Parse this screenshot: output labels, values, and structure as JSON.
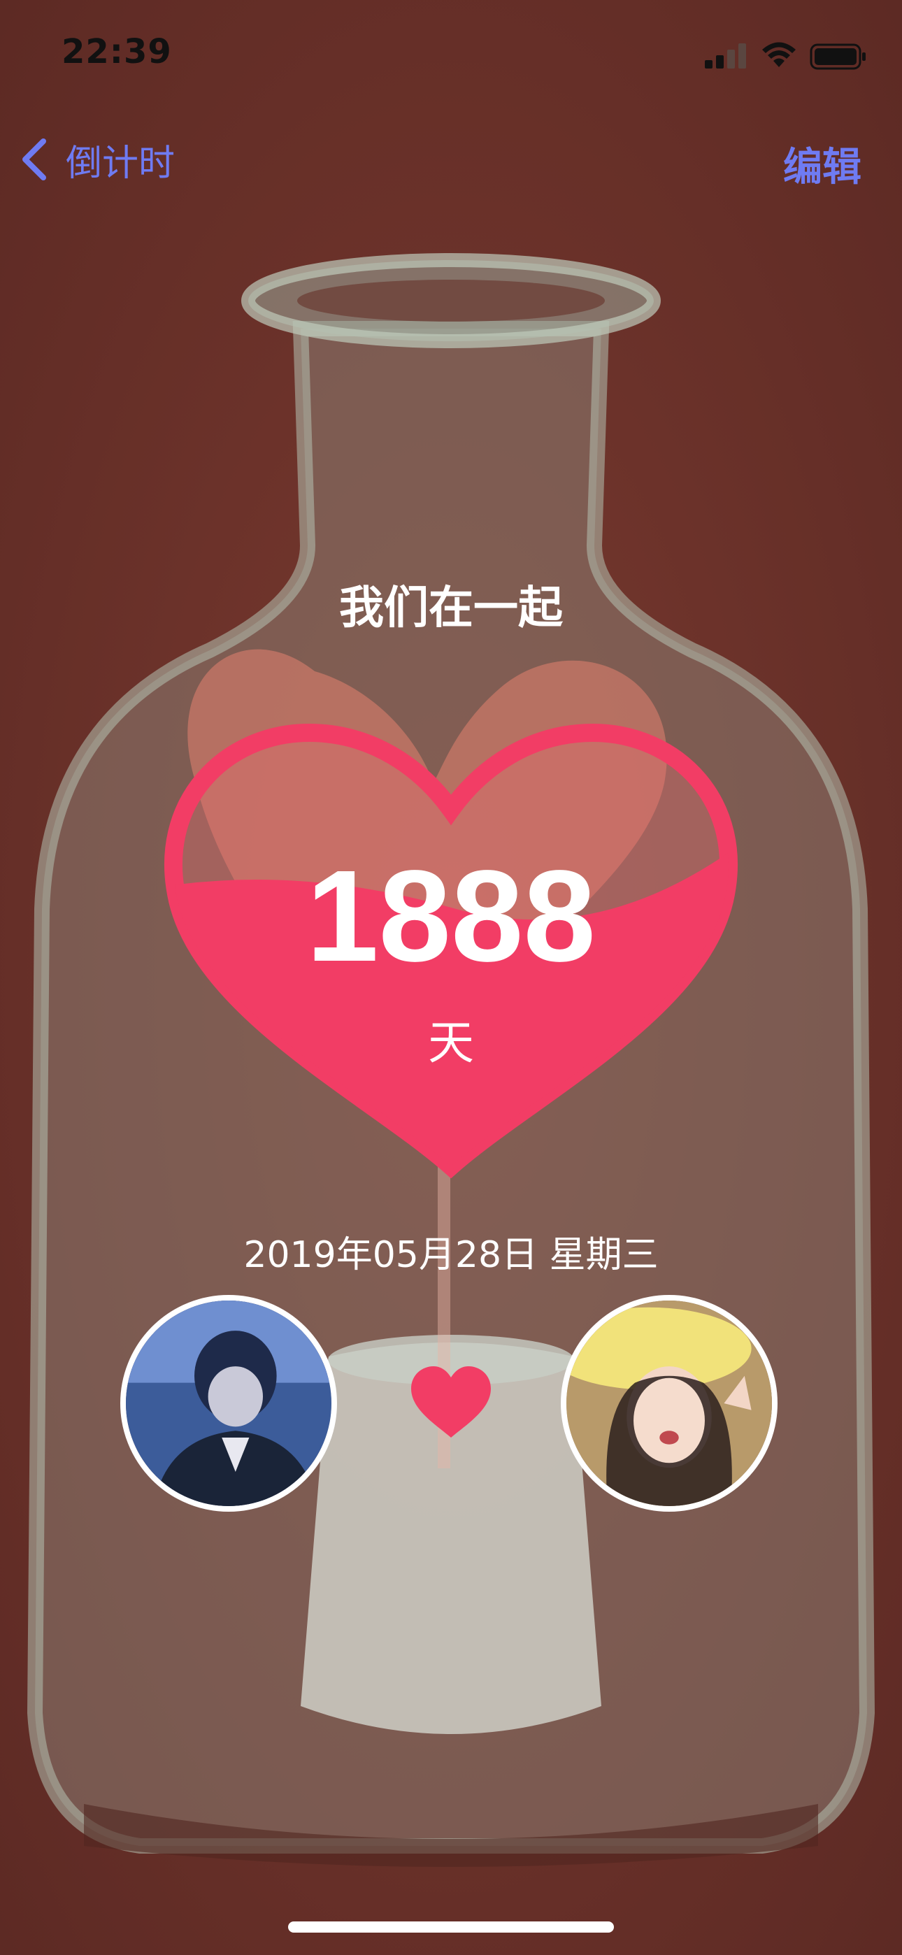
{
  "status_bar": {
    "time": "22:39"
  },
  "nav": {
    "back_label": "倒计时",
    "edit_label": "编辑"
  },
  "main": {
    "title": "我们在一起",
    "day_count": "1888",
    "day_unit": "天",
    "date": "2019年05月28日  星期三"
  },
  "icons": [
    "back-chevron-icon",
    "signal-icon",
    "wifi-icon",
    "battery-icon",
    "heart-icon"
  ],
  "colors": {
    "accent": "#6f7bf2",
    "heart": "#f23d65",
    "background": "#6f352c",
    "text": "#ffffff"
  }
}
